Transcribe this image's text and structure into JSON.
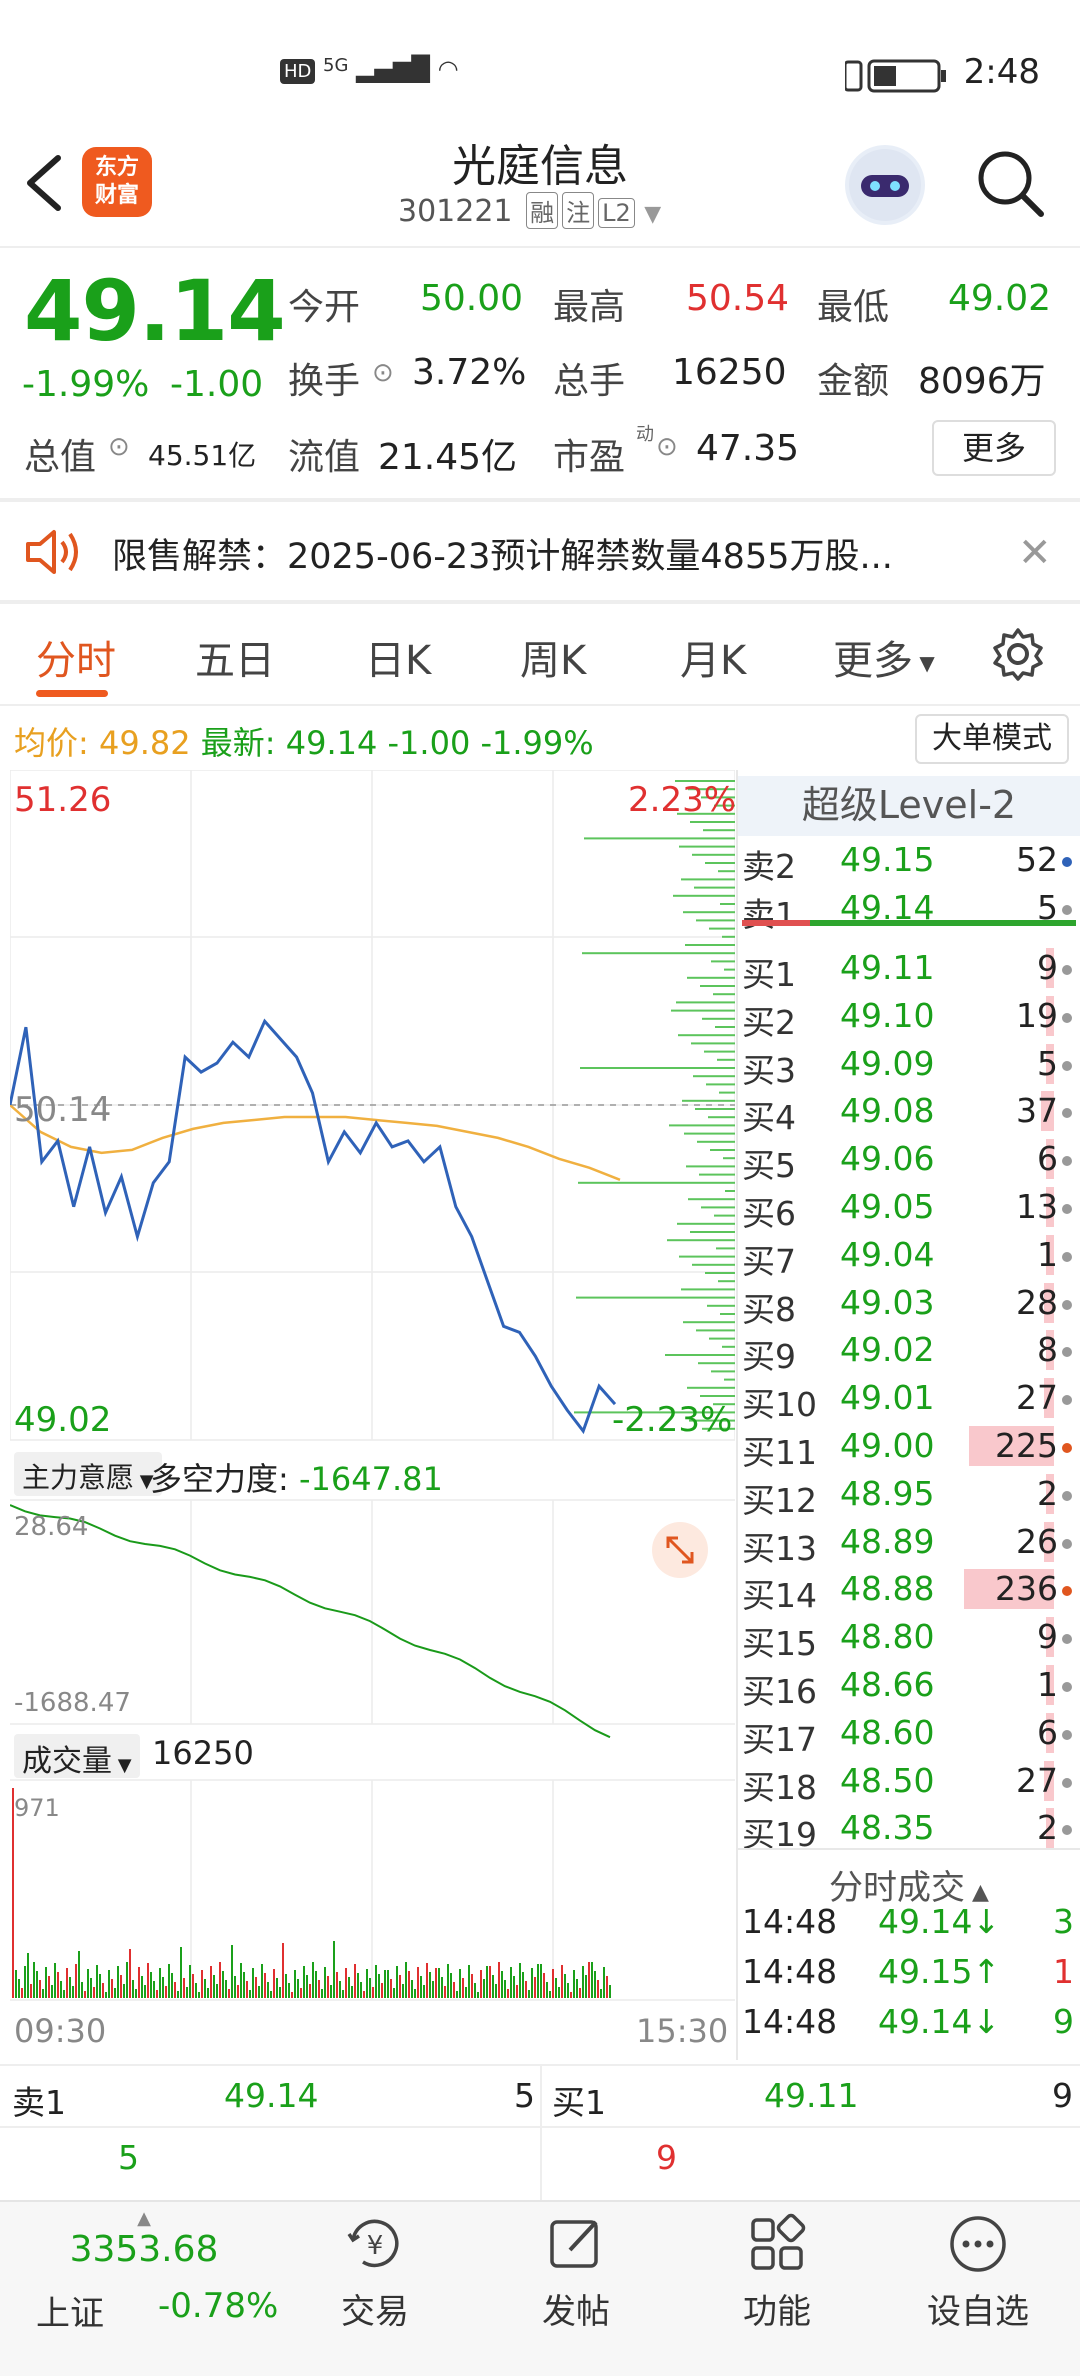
{
  "status": {
    "network": "5G",
    "time": "2:48"
  },
  "header": {
    "logo_line1": "东方",
    "logo_line2": "财富",
    "title": "光庭信息",
    "code": "301221",
    "tags": [
      "融",
      "注",
      "L2"
    ]
  },
  "quote": {
    "price": "49.14",
    "change_pct": "-1.99%",
    "change": "-1.00",
    "open_label": "今开",
    "open": "50.00",
    "high_label": "最高",
    "high": "50.54",
    "low_label": "最低",
    "low": "49.02",
    "turnover_label": "换手",
    "turnover": "3.72%",
    "volume_label": "总手",
    "volume": "16250",
    "amount_label": "金额",
    "amount": "8096万",
    "mktcap_label": "总值",
    "mktcap": "45.51亿",
    "float_label": "流值",
    "float": "21.45亿",
    "pe_label": "市盈",
    "pe_sup": "动",
    "pe": "47.35",
    "more": "更多"
  },
  "notice": {
    "text": "限售解禁：2025-06-23预计解禁数量4855万股..."
  },
  "tabs": [
    "分时",
    "五日",
    "日K",
    "周K",
    "月K",
    "更多"
  ],
  "infoline": {
    "avg_label": "均价:",
    "avg": "49.82",
    "last_label": "最新:",
    "last": "49.14",
    "chg": "-1.00",
    "pct": "-1.99%",
    "big_order": "大单模式"
  },
  "chart": {
    "y_max": "51.26",
    "y_max_pct": "2.23%",
    "y_mid": "50.14",
    "y_min": "49.02",
    "y_min_pct": "-2.23%",
    "indicator_label": "主力意愿",
    "indicator_name": "多空力度:",
    "indicator_value": "-1647.81",
    "ind_top": "28.64",
    "ind_bottom": "-1688.47",
    "vol_label": "成交量",
    "vol_value": "16250",
    "vol_max": "971",
    "time_start": "09:30",
    "time_end": "15:30"
  },
  "chart_data": {
    "type": "line",
    "title": "",
    "xlabel": "",
    "ylabel": "",
    "ylim": [
      49.02,
      51.26
    ],
    "series": [
      {
        "values": [
          50.14,
          50.4,
          49.95,
          50.02,
          49.8,
          50.0,
          49.78,
          49.9,
          49.7,
          49.88,
          49.95,
          50.3,
          50.25,
          50.28,
          50.35,
          50.3,
          50.42,
          50.36,
          50.3,
          50.18,
          49.95,
          50.05,
          49.98,
          50.08,
          50.0,
          50.02,
          49.95,
          50.0,
          49.8,
          49.7,
          49.55,
          49.4,
          49.38,
          49.3,
          49.2,
          49.12,
          49.05,
          49.2,
          49.14
        ]
      },
      {
        "values": [
          50.14,
          50.05,
          50.0,
          49.98,
          49.99,
          50.03,
          50.06,
          50.08,
          50.09,
          50.1,
          50.1,
          50.1,
          50.09,
          50.08,
          50.07,
          50.05,
          50.03,
          50.0,
          49.96,
          49.93,
          49.89
        ]
      }
    ]
  },
  "level2": {
    "title": "超级Level-2",
    "sells": [
      {
        "label": "卖2",
        "price": "49.15",
        "qty": "52"
      },
      {
        "label": "卖1",
        "price": "49.14",
        "qty": "5"
      }
    ],
    "buys": [
      {
        "label": "买1",
        "price": "49.11",
        "qty": "9",
        "bar": 0.03
      },
      {
        "label": "买2",
        "price": "49.10",
        "qty": "19",
        "bar": 0.04
      },
      {
        "label": "买3",
        "price": "49.09",
        "qty": "5",
        "bar": 0.02
      },
      {
        "label": "买4",
        "price": "49.08",
        "qty": "37",
        "bar": 0.08
      },
      {
        "label": "买5",
        "price": "49.06",
        "qty": "6",
        "bar": 0.02
      },
      {
        "label": "买6",
        "price": "49.05",
        "qty": "13",
        "bar": 0.03
      },
      {
        "label": "买7",
        "price": "49.04",
        "qty": "1",
        "bar": 0.01
      },
      {
        "label": "买8",
        "price": "49.03",
        "qty": "28",
        "bar": 0.06
      },
      {
        "label": "买9",
        "price": "49.02",
        "qty": "8",
        "bar": 0.02
      },
      {
        "label": "买10",
        "price": "49.01",
        "qty": "27",
        "bar": 0.06
      },
      {
        "label": "买11",
        "price": "49.00",
        "qty": "225",
        "bar": 0.53
      },
      {
        "label": "买12",
        "price": "48.95",
        "qty": "2",
        "bar": 0.01
      },
      {
        "label": "买13",
        "price": "48.89",
        "qty": "26",
        "bar": 0.06
      },
      {
        "label": "买14",
        "price": "48.88",
        "qty": "236",
        "bar": 0.56
      },
      {
        "label": "买15",
        "price": "48.80",
        "qty": "9",
        "bar": 0.02
      },
      {
        "label": "买16",
        "price": "48.66",
        "qty": "1",
        "bar": 0.01
      },
      {
        "label": "买17",
        "price": "48.60",
        "qty": "6",
        "bar": 0.02
      },
      {
        "label": "买18",
        "price": "48.50",
        "qty": "27",
        "bar": 0.06
      },
      {
        "label": "买19",
        "price": "48.35",
        "qty": "2",
        "bar": 0.01
      }
    ],
    "trades_title": "分时成交",
    "trades": [
      {
        "time": "14:48",
        "price": "49.14↓",
        "qty": "3",
        "dir": "down"
      },
      {
        "time": "14:48",
        "price": "49.15↑",
        "qty": "1",
        "dir": "up"
      },
      {
        "time": "14:48",
        "price": "49.14↓",
        "qty": "9",
        "dir": "down"
      }
    ]
  },
  "strip": {
    "sell_label": "卖1",
    "sell_price": "49.14",
    "sell_qty": "5",
    "buy_label": "买1",
    "buy_price": "49.11",
    "buy_qty": "9",
    "sell_sub": "5",
    "buy_sub": "9"
  },
  "bottomnav": {
    "index_value": "3353.68",
    "index_name": "上证",
    "index_pct": "-0.78%",
    "items": [
      "交易",
      "发帖",
      "功能",
      "设自选"
    ]
  }
}
